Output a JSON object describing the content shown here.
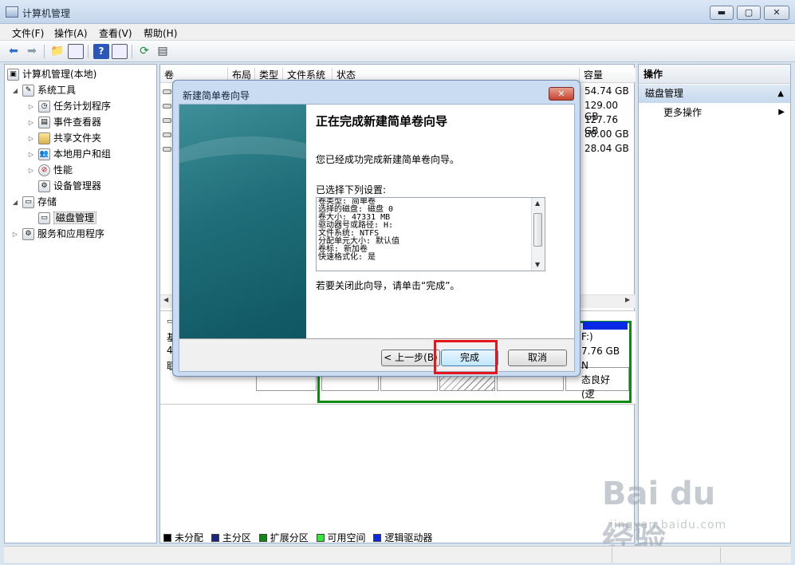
{
  "window": {
    "title": "计算机管理",
    "controls": {
      "minimize": "▬",
      "maximize": "▢",
      "close": "✕"
    }
  },
  "menu": [
    "文件(F)",
    "操作(A)",
    "查看(V)",
    "帮助(H)"
  ],
  "toolbar": {
    "icons": [
      "back-arrow-icon",
      "forward-arrow-icon",
      "up-folder-icon",
      "show-hide-tree-icon",
      "help-icon",
      "properties-icon",
      "refresh-icon",
      "export-list-icon"
    ]
  },
  "tree": {
    "root": "计算机管理(本地)",
    "items": [
      {
        "label": "系统工具",
        "expanded": true
      },
      {
        "label": "任务计划程序"
      },
      {
        "label": "事件查看器"
      },
      {
        "label": "共享文件夹"
      },
      {
        "label": "本地用户和组"
      },
      {
        "label": "性能"
      },
      {
        "label": "设备管理器"
      },
      {
        "label": "存储",
        "expanded": true
      },
      {
        "label": "磁盘管理",
        "selected": true
      },
      {
        "label": "服务和应用程序"
      }
    ]
  },
  "volume_list": {
    "columns": [
      "卷",
      "布局",
      "类型",
      "文件系统",
      "状态",
      "容量"
    ],
    "capacities": [
      "54.74 GB",
      "129.00 GB",
      "127.76 GB",
      "80.00 GB",
      "28.04 GB"
    ]
  },
  "disk_graph": {
    "left_fragments": [
      "基",
      "4",
      "联"
    ],
    "logical_drive": {
      "name": "F:)",
      "size": "7.76 GB N",
      "status": "态良好 (逻"
    }
  },
  "legend": [
    {
      "label": "未分配",
      "color": "#000000"
    },
    {
      "label": "主分区",
      "color": "#1a237e"
    },
    {
      "label": "扩展分区",
      "color": "#0e8a14"
    },
    {
      "label": "可用空间",
      "color": "#35e63a"
    },
    {
      "label": "逻辑驱动器",
      "color": "#0a28e8"
    }
  ],
  "actions": {
    "header": "操作",
    "section": "磁盘管理",
    "more": "更多操作"
  },
  "watermark": {
    "logo": "Bai du 经验",
    "url": "jingyan.baidu.com"
  },
  "dialog": {
    "title": "新建简单卷向导",
    "close": "✕",
    "heading": "正在完成新建简单卷向导",
    "message": "您已经成功完成新建简单卷向导。",
    "settings_label": "已选择下列设置:",
    "settings": [
      "卷类型: 简单卷",
      "选择的磁盘: 磁盘 0",
      "卷大小: 47331 MB",
      "驱动器号或路径: H:",
      "文件系统: NTFS",
      "分配单元大小: 默认值",
      "卷标: 新加卷",
      "快速格式化: 是"
    ],
    "close_hint": "若要关闭此向导，请单击“完成”。",
    "buttons": {
      "back": "< 上一步(B)",
      "finish": "完成",
      "cancel": "取消"
    }
  }
}
